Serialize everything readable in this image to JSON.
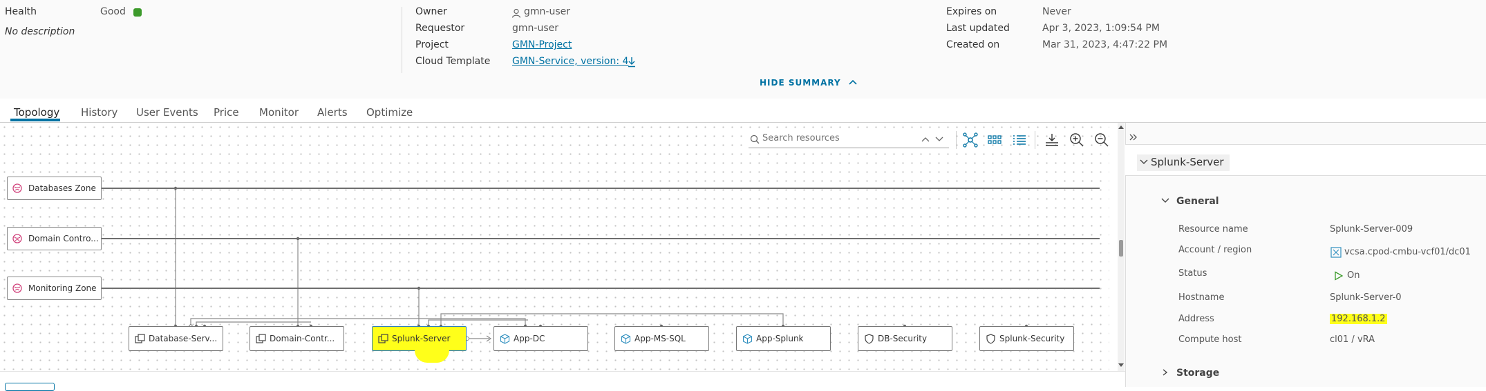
{
  "summary": {
    "health_label": "Health",
    "health_value": "Good",
    "health_color": "#3c9a2b",
    "description": "No description",
    "owner_label": "Owner",
    "owner_value": "gmn-user",
    "requestor_label": "Requestor",
    "requestor_value": "gmn-user",
    "project_label": "Project",
    "project_value": "GMN-Project",
    "template_label": "Cloud Template",
    "template_value": "GMN-Service, version: 4",
    "expires_label": "Expires on",
    "expires_value": "Never",
    "updated_label": "Last updated",
    "updated_value": "Apr 3, 2023, 1:09:54 PM",
    "created_label": "Created on",
    "created_value": "Mar 31, 2023, 4:47:22 PM",
    "hide_summary": "HIDE SUMMARY"
  },
  "tabs": [
    "Topology",
    "History",
    "User Events",
    "Price",
    "Monitor",
    "Alerts",
    "Optimize"
  ],
  "toolbar": {
    "search_placeholder": "Search resources"
  },
  "zones": [
    "Databases Zone",
    "Domain Contro...",
    "Monitoring Zone"
  ],
  "nodes": [
    "Database-Serv...",
    "Domain-Contr...",
    "Splunk-Server",
    "App-DC",
    "App-MS-SQL",
    "App-Splunk",
    "DB-Security",
    "Splunk-Security"
  ],
  "selected_node": "Splunk-Server",
  "colors": {
    "accent": "#0072a3",
    "zone_icon": "#d0407a",
    "highlight": "#ffff1a"
  },
  "panel": {
    "title": "Splunk-Server",
    "section_general": "General",
    "section_storage": "Storage",
    "props": [
      {
        "label": "Resource name",
        "value": "Splunk-Server-009"
      },
      {
        "label": "Account / region",
        "value": "vcsa.cpod-cmbu-vcf01/dc01"
      },
      {
        "label": "Status",
        "value": "On"
      },
      {
        "label": "Hostname",
        "value": "Splunk-Server-0"
      },
      {
        "label": "Address",
        "value": "192.168.1.2"
      },
      {
        "label": "Compute host",
        "value": "cl01 / vRA"
      }
    ]
  }
}
